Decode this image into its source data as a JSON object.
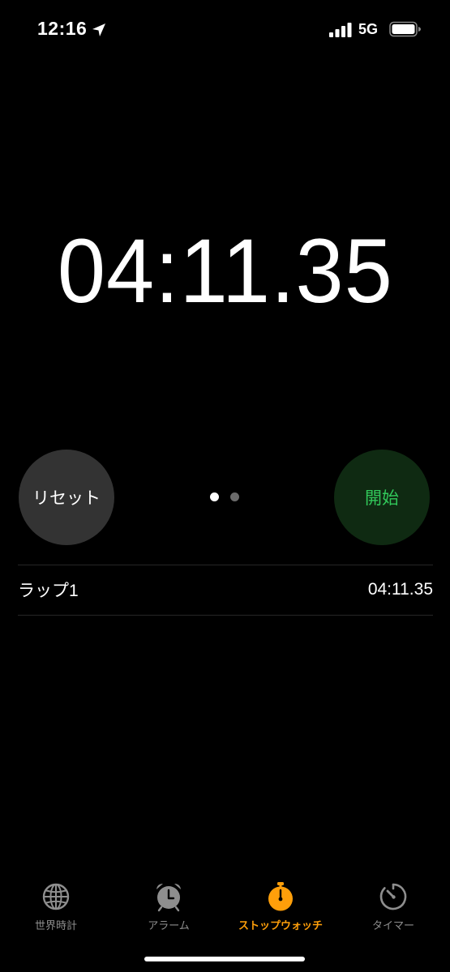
{
  "status_bar": {
    "time": "12:16",
    "network": "5G",
    "icons": [
      "location-arrow-icon",
      "signal-bars-icon",
      "battery-icon"
    ]
  },
  "stopwatch": {
    "elapsed": "04:11.35",
    "reset_label": "リセット",
    "start_label": "開始",
    "page_count": 2,
    "active_page": 1
  },
  "laps": [
    {
      "label": "ラップ1",
      "time": "04:11.35"
    }
  ],
  "tab_bar": {
    "items": [
      {
        "label": "世界時計",
        "icon": "globe-icon",
        "active": false
      },
      {
        "label": "アラーム",
        "icon": "alarm-clock-icon",
        "active": false
      },
      {
        "label": "ストップウォッチ",
        "icon": "stopwatch-icon",
        "active": true
      },
      {
        "label": "タイマー",
        "icon": "timer-icon",
        "active": false
      }
    ]
  },
  "colors": {
    "background": "#000000",
    "reset_button_bg": "#333333",
    "start_button_bg": "#0f2a12",
    "start_button_text": "#31c85a",
    "tab_active": "#ff9f0a",
    "tab_inactive": "#8e8e8e"
  }
}
